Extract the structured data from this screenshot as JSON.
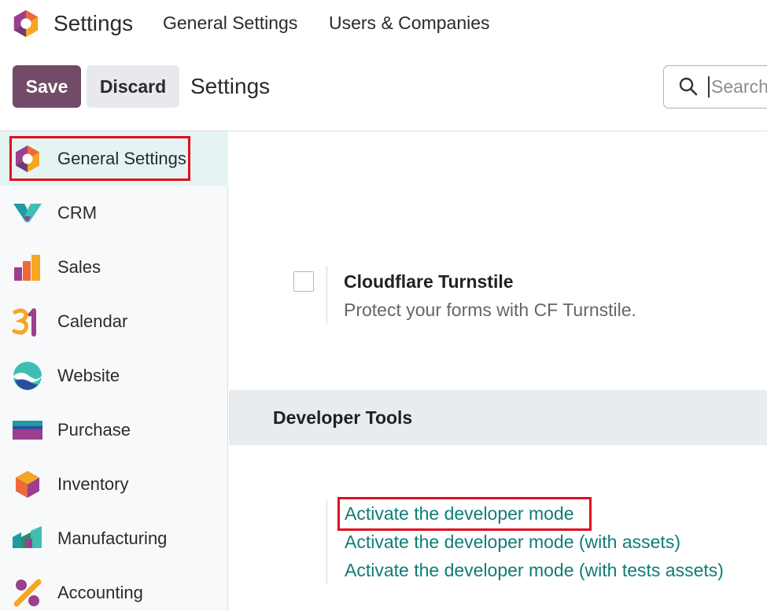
{
  "navbar": {
    "app_title": "Settings",
    "menu": [
      "General Settings",
      "Users & Companies"
    ]
  },
  "control_panel": {
    "save_label": "Save",
    "discard_label": "Discard",
    "breadcrumb": "Settings",
    "search_placeholder": "Search..."
  },
  "sidebar": {
    "items": [
      {
        "label": "General Settings",
        "icon": "odoo-settings-icon",
        "active": true
      },
      {
        "label": "CRM",
        "icon": "crm-icon"
      },
      {
        "label": "Sales",
        "icon": "sales-icon"
      },
      {
        "label": "Calendar",
        "icon": "calendar-icon"
      },
      {
        "label": "Website",
        "icon": "website-icon"
      },
      {
        "label": "Purchase",
        "icon": "purchase-icon"
      },
      {
        "label": "Inventory",
        "icon": "inventory-icon"
      },
      {
        "label": "Manufacturing",
        "icon": "manufacturing-icon"
      },
      {
        "label": "Accounting",
        "icon": "accounting-icon"
      }
    ]
  },
  "settings": {
    "cloudflare": {
      "title": "Cloudflare Turnstile",
      "description": "Protect your forms with CF Turnstile.",
      "checked": false
    }
  },
  "developer_tools": {
    "title": "Developer Tools",
    "links": [
      "Activate the developer mode",
      "Activate the developer mode (with assets)",
      "Activate the developer mode (with tests assets)"
    ]
  },
  "colors": {
    "brand": "#714b67",
    "link": "#0f7c76",
    "highlight": "#e0101f",
    "active_bg": "#e6f3f3"
  }
}
